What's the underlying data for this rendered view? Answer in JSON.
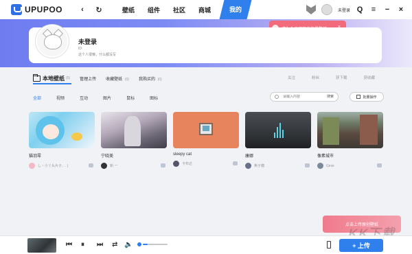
{
  "app": {
    "logo_text": "UPUPOO"
  },
  "nav": {
    "items": [
      "壁纸",
      "组件",
      "社区",
      "商城"
    ],
    "active": "我的"
  },
  "top_right": {
    "login": "未登录"
  },
  "tooltip": {
    "text": "成为会员可畅享海量壁纸",
    "close": "×"
  },
  "profile": {
    "name": "未登录",
    "id": "ID:",
    "signature": "这个人很懒，什么都没写"
  },
  "tabs": {
    "local": {
      "label": "本地壁纸",
      "count": "(5)"
    },
    "managed": {
      "label": "管理上传"
    },
    "favorites": {
      "label": "收藏壁纸",
      "count": "(0)"
    },
    "purchased": {
      "label": "我购买的",
      "count": "(0)"
    }
  },
  "stats": {
    "follow": "关注",
    "fans": "粉丝",
    "downloads": "获下载",
    "favorited": "获收藏"
  },
  "filters": [
    "全部",
    "视频",
    "互动",
    "图片",
    "鼠标",
    "图标"
  ],
  "search": {
    "placeholder": "请输入内容",
    "button": "搜索"
  },
  "batch": {
    "label": "批量操作"
  },
  "cards": [
    {
      "title": "猫羽零",
      "author": "し・小丫头片子、. )"
    },
    {
      "title": "宁晓美",
      "author": "新·一"
    },
    {
      "title": "sleepy cat",
      "author": "卡布达"
    },
    {
      "title": "康娜",
      "author": "焦子糖"
    },
    {
      "title": "像素城市",
      "author": "Ginie"
    }
  ],
  "promo": {
    "label": "点击上传原创壁纸"
  },
  "player": {
    "volume": 0.2,
    "upload": "+ 上传"
  },
  "watermark": "KK下载",
  "colors": {
    "accent": "#2f80ed",
    "promo": "#f07b8c",
    "banner": "#6e7cf0"
  }
}
